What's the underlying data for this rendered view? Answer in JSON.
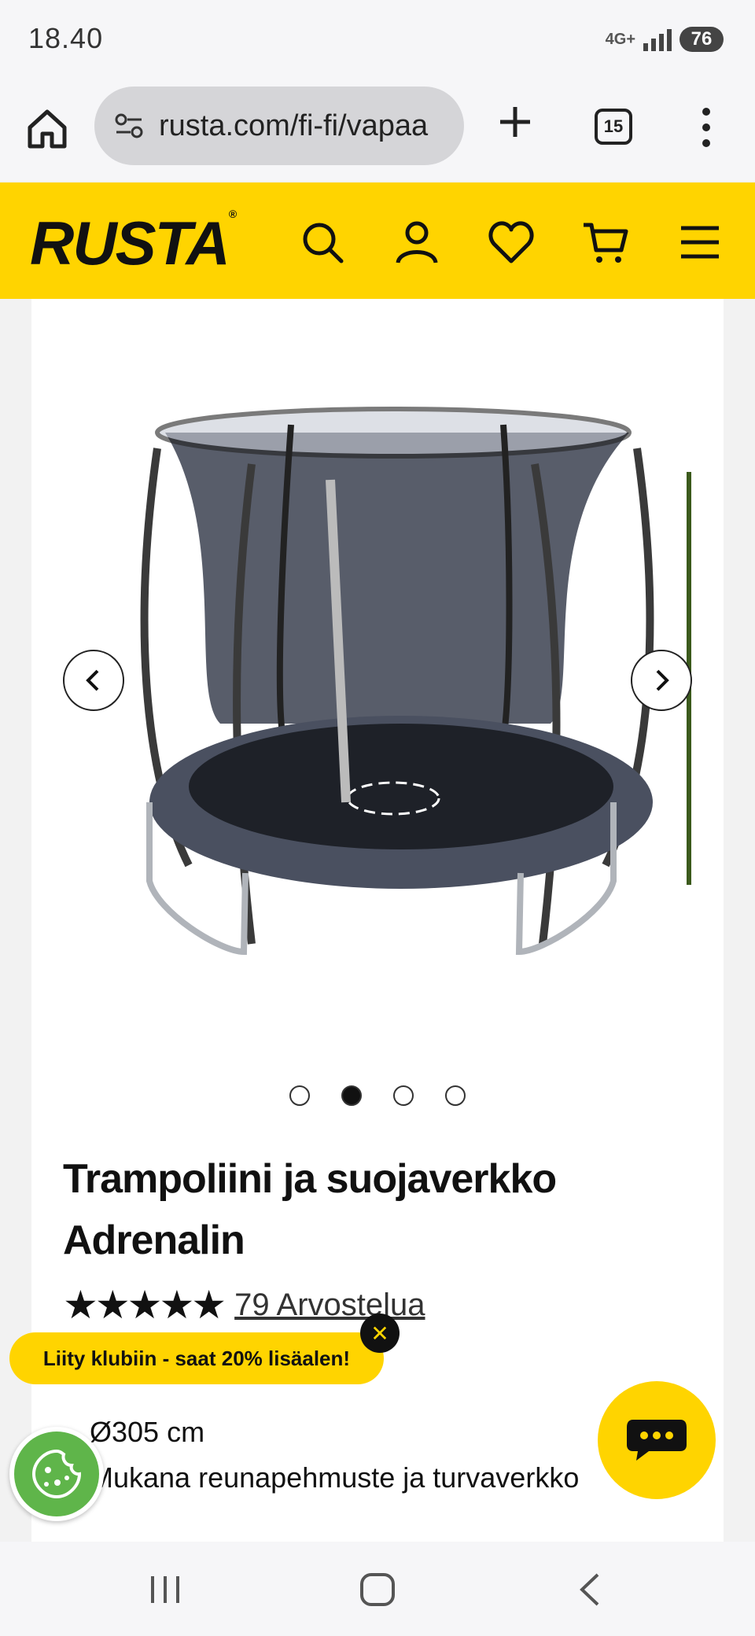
{
  "status_bar": {
    "time": "18.40",
    "network": "4G+",
    "battery": "76"
  },
  "browser": {
    "url": "rusta.com/fi-fi/vapaa",
    "tab_count": "15"
  },
  "site": {
    "logo": "RUSTA",
    "brand_color": "#ffd400"
  },
  "product": {
    "title": "Trampoliini ja suojaverkko Adrenalin",
    "stars": "★★★★★",
    "rating": 5,
    "rating_max": 5,
    "reviews_label": "79 Arvostelua",
    "gallery_active_index": 1,
    "gallery_count": 4,
    "features": [
      "Ø305 cm",
      "Mukana reunapehmuste ja turvaverkko"
    ]
  },
  "club_banner": {
    "text": "Liity klubiin - saat 20% lisäalen!",
    "close": "✕"
  }
}
